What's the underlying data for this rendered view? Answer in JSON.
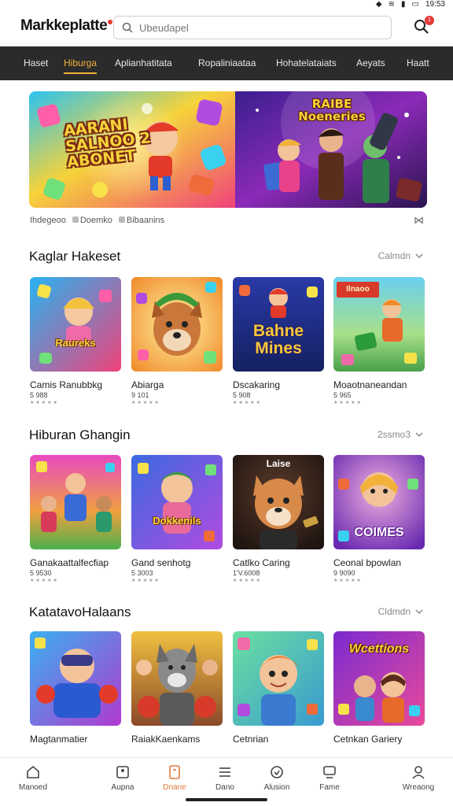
{
  "status": {
    "time": "19:53"
  },
  "header": {
    "logo": "Markkeplatte",
    "search_placeholder": "Ubeudapel",
    "cart_count": "1"
  },
  "nav": {
    "tabs": [
      {
        "label": "Haset"
      },
      {
        "label": "Hiburga",
        "active": true
      },
      {
        "label": "Aplianhatitata"
      },
      {
        "label": "Ropaliniaataa"
      },
      {
        "label": "Hohatelataiats"
      },
      {
        "label": "Aeyats"
      },
      {
        "label": "Haatt"
      }
    ]
  },
  "hero": {
    "left_title": "AARANI SALNOO 2 ABONET",
    "right_title": "RAIBE Noeneries",
    "caption_items": [
      "Ihdegeoo",
      "Doemko",
      "Bibaanins"
    ]
  },
  "sections": [
    {
      "title": "Kaglar Hakeset",
      "see_all": "Calmdn",
      "items": [
        {
          "name": "Camis Ranubbkg",
          "price": "5 988",
          "art": "Raureks",
          "rating": "★★★★★"
        },
        {
          "name": "Abiarga",
          "price": "9 101",
          "art": "",
          "rating": "★★★★★"
        },
        {
          "name": "Dscakaring",
          "price": "5 908",
          "art": "Bahne Mines",
          "rating": "★★★★★"
        },
        {
          "name": "Moaotnaneandan",
          "price": "5 965",
          "art": "Ilnaoo",
          "rating": "★★★★★"
        }
      ]
    },
    {
      "title": "Hiburan Ghangin",
      "see_all": "2ssmo3",
      "items": [
        {
          "name": "Ganakaattalfecfiap",
          "price": "5 9530",
          "art": "",
          "rating": "★★★★★"
        },
        {
          "name": "Gand senhotg",
          "price": "5 3003",
          "art": "Dokkenils",
          "rating": "★★★★★"
        },
        {
          "name": "Catlko Caring",
          "price": "1'V.6008",
          "art": "Laise",
          "rating": "★★★★★"
        },
        {
          "name": "Ceonal bpowlan",
          "price": "9 9090",
          "art": "COIMES",
          "rating": "★★★★★"
        }
      ]
    },
    {
      "title": "KatatavoHalaans",
      "see_all": "Cldmdn",
      "items": [
        {
          "name": "Magtanmatier",
          "price": "",
          "art": "",
          "rating": ""
        },
        {
          "name": "RaiakKaenkams",
          "price": "",
          "art": "",
          "rating": ""
        },
        {
          "name": "Cetnrian",
          "price": "",
          "art": "",
          "rating": ""
        },
        {
          "name": "Cetnkan Gariery",
          "price": "",
          "art": "Wcettions",
          "rating": ""
        }
      ]
    }
  ],
  "bottom_nav": [
    {
      "label": "Manoed",
      "icon": "home-icon"
    },
    {
      "label": "Aupna",
      "icon": "apps-icon"
    },
    {
      "label": "Dnane",
      "icon": "games-icon",
      "active": true
    },
    {
      "label": "Dano",
      "icon": "list-icon"
    },
    {
      "label": "Alusion",
      "icon": "favorites-icon"
    },
    {
      "label": "Fame",
      "icon": "chat-icon"
    },
    {
      "label": "Wreaong",
      "icon": "profile-icon"
    }
  ],
  "colors": {
    "nav_bg": "#2b2b2b",
    "active_tab": "#f2b23a",
    "active_bottom": "#e07a3a",
    "badge": "#e53935"
  }
}
